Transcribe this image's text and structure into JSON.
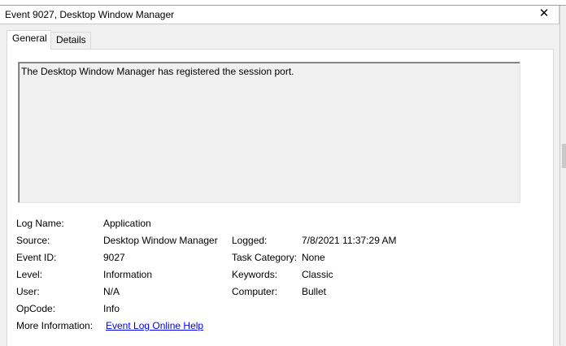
{
  "window": {
    "title": "Event 9027, Desktop Window Manager",
    "close_glyph": "✕"
  },
  "tabs": [
    {
      "label": "General",
      "active": true
    },
    {
      "label": "Details",
      "active": false
    }
  ],
  "event": {
    "description": "The Desktop Window Manager has registered the session port.",
    "labels": {
      "log_name": "Log Name:",
      "source": "Source:",
      "event_id": "Event ID:",
      "level": "Level:",
      "user": "User:",
      "opcode": "OpCode:",
      "more_info": "More Information:",
      "logged": "Logged:",
      "task_category": "Task Category:",
      "keywords": "Keywords:",
      "computer": "Computer:"
    },
    "values": {
      "log_name": "Application",
      "source": "Desktop Window Manager",
      "event_id": "9027",
      "level": "Information",
      "user": "N/A",
      "opcode": "Info",
      "more_info_link": "Event Log Online Help",
      "logged": "7/8/2021 11:37:29 AM",
      "task_category": "None",
      "keywords": "Classic",
      "computer": "Bullet"
    }
  },
  "icons": {
    "close": "close-icon"
  }
}
